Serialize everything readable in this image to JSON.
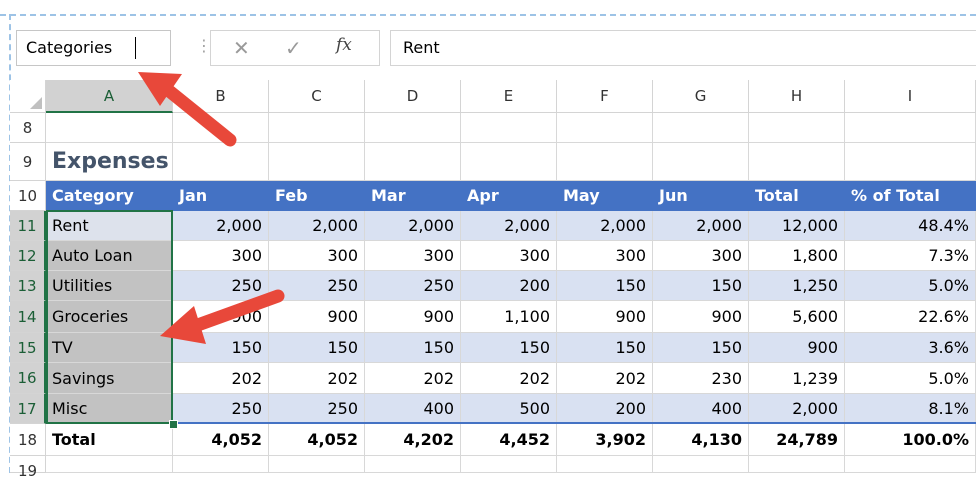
{
  "name_box": {
    "value": "Categories"
  },
  "formula_bar": {
    "cancel_icon": "close-icon",
    "enter_icon": "check-icon",
    "fx_label": "fx",
    "content": "Rent"
  },
  "columns": [
    "A",
    "B",
    "C",
    "D",
    "E",
    "F",
    "G",
    "H",
    "I"
  ],
  "rows": {
    "r8": "8",
    "r9": "9",
    "r10": "10",
    "r11": "11",
    "r12": "12",
    "r13": "13",
    "r14": "14",
    "r15": "15",
    "r16": "16",
    "r17": "17",
    "r18": "18",
    "r19": "19"
  },
  "sheet": {
    "title": "Expenses",
    "header": [
      "Category",
      "Jan",
      "Feb",
      "Mar",
      "Apr",
      "May",
      "Jun",
      "Total",
      "% of Total"
    ],
    "data": [
      [
        "Rent",
        "2,000",
        "2,000",
        "2,000",
        "2,000",
        "2,000",
        "2,000",
        "12,000",
        "48.4%"
      ],
      [
        "Auto Loan",
        "300",
        "300",
        "300",
        "300",
        "300",
        "300",
        "1,800",
        "7.3%"
      ],
      [
        "Utilities",
        "250",
        "250",
        "250",
        "200",
        "150",
        "150",
        "1,250",
        "5.0%"
      ],
      [
        "Groceries",
        "900",
        "900",
        "900",
        "1,100",
        "900",
        "900",
        "5,600",
        "22.6%"
      ],
      [
        "TV",
        "150",
        "150",
        "150",
        "150",
        "150",
        "150",
        "900",
        "3.6%"
      ],
      [
        "Savings",
        "202",
        "202",
        "202",
        "202",
        "202",
        "230",
        "1,239",
        "5.0%"
      ],
      [
        "Misc",
        "250",
        "250",
        "400",
        "500",
        "200",
        "400",
        "2,000",
        "8.1%"
      ]
    ],
    "total": [
      "Total",
      "4,052",
      "4,052",
      "4,202",
      "4,452",
      "3,902",
      "4,130",
      "24,789",
      "100.0%"
    ]
  },
  "colors": {
    "header_fill": "#4472c4",
    "band_fill": "#d9e1f2",
    "selection": "#217346",
    "arrow": "#e8483a",
    "title": "#44546a"
  }
}
